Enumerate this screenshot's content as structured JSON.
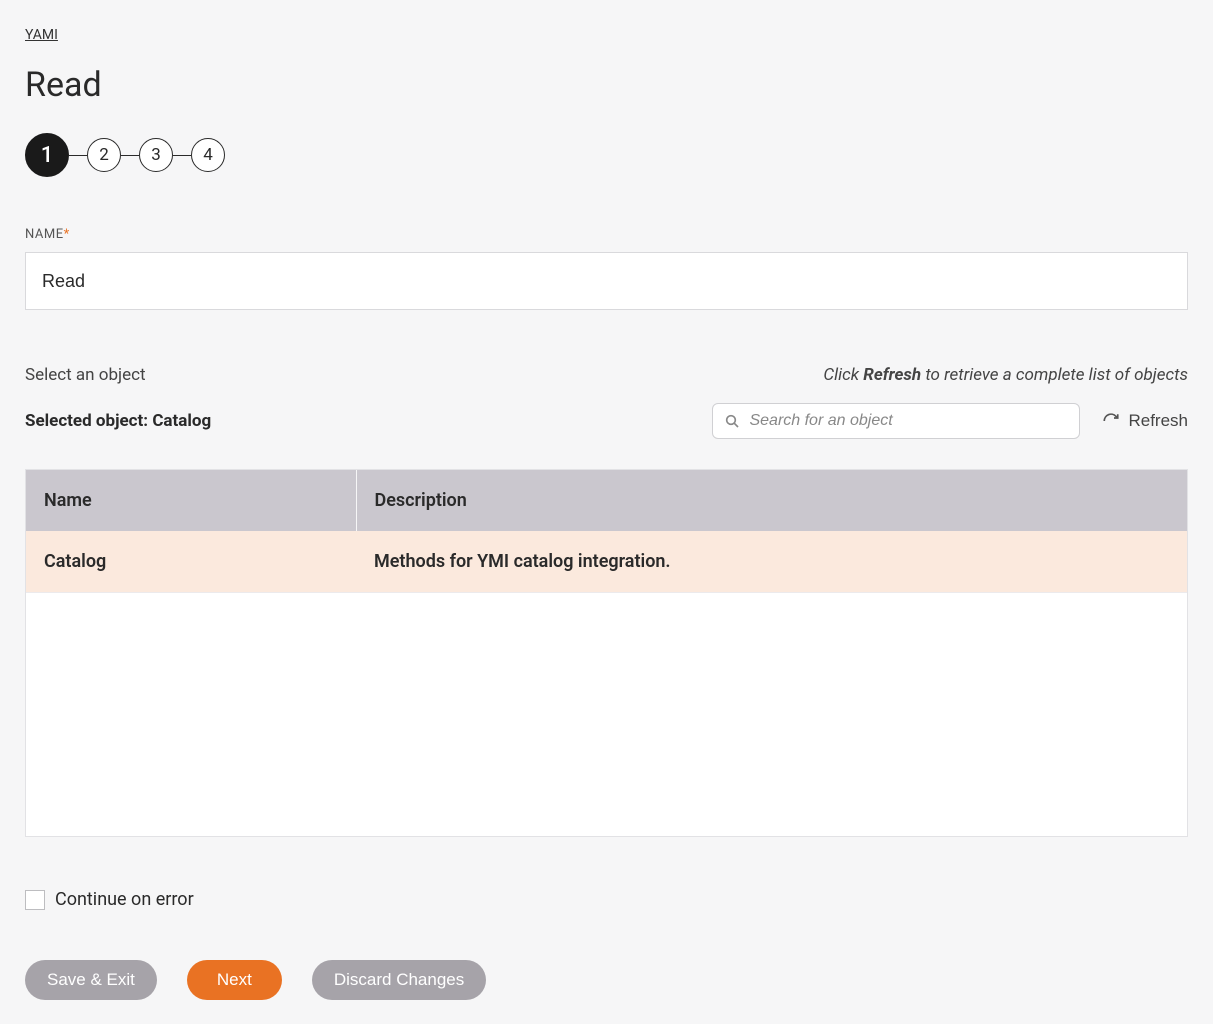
{
  "breadcrumb": "YAMI",
  "page_title": "Read",
  "stepper": {
    "steps": [
      "1",
      "2",
      "3",
      "4"
    ],
    "active_index": 0
  },
  "name_field": {
    "label": "NAME",
    "value": "Read"
  },
  "select_object_label": "Select an object",
  "refresh_hint": {
    "prefix": "Click ",
    "bold": "Refresh",
    "suffix": " to retrieve a complete list of objects"
  },
  "selected_object": {
    "prefix": "Selected object: ",
    "value": "Catalog"
  },
  "search": {
    "placeholder": "Search for an object"
  },
  "refresh_button": "Refresh",
  "table": {
    "headers": {
      "name": "Name",
      "description": "Description"
    },
    "rows": [
      {
        "name": "Catalog",
        "description": "Methods for YMI catalog integration.",
        "selected": true
      }
    ]
  },
  "continue_on_error_label": "Continue on error",
  "buttons": {
    "save_exit": "Save & Exit",
    "next": "Next",
    "discard": "Discard Changes"
  }
}
